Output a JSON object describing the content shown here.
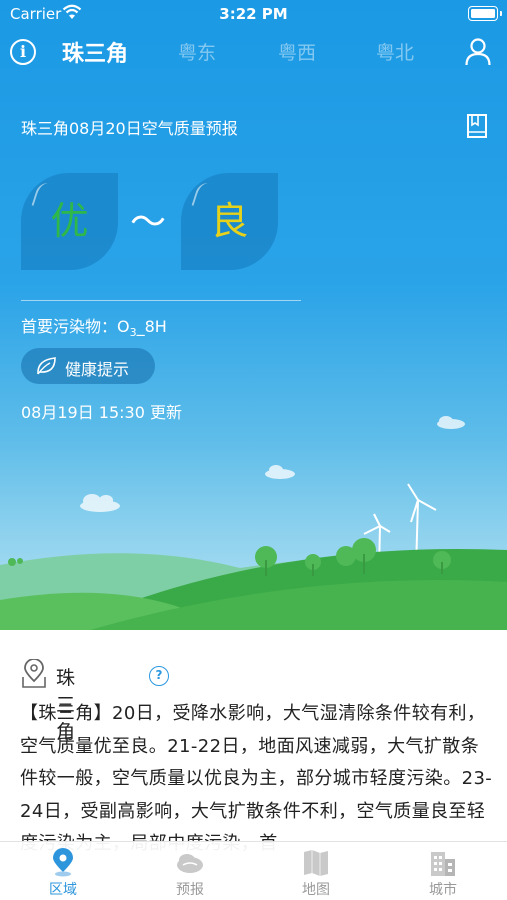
{
  "status_bar": {
    "carrier": "Carrier",
    "time": "3:22 PM"
  },
  "nav": {
    "tabs": [
      {
        "label": "珠三角",
        "active": true
      },
      {
        "label": "粤东",
        "active": false
      },
      {
        "label": "粤西",
        "active": false
      },
      {
        "label": "粤北",
        "active": false
      }
    ]
  },
  "forecast": {
    "title": "珠三角08月20日空气质量预报",
    "level_from": "优",
    "level_from_color": "#2fb84a",
    "separator": "～",
    "level_to": "良",
    "level_to_color": "#e7d21b",
    "pollutant_label": "首要污染物：",
    "pollutant_main": "O",
    "pollutant_sub": "3",
    "pollutant_suffix": "_8H",
    "health_button": "健康提示",
    "updated": "08月19日 15:30 更新"
  },
  "region": {
    "name": "珠三角",
    "help": "?",
    "description": "【珠三角】20日，受降水影响，大气湿清除条件较有利，空气质量优至良。21-22日，地面风速减弱，大气扩散条件较一般，空气质量以优良为主，部分城市轻度污染。23-24日，受副高影响，大气扩散条件不利，空气质量良至轻度污染为主，局部中度污染，首"
  },
  "tabbar": {
    "items": [
      {
        "label": "区域",
        "icon": "map-pin-icon",
        "active": true
      },
      {
        "label": "预报",
        "icon": "cloud-icon",
        "active": false
      },
      {
        "label": "地图",
        "icon": "folded-map-icon",
        "active": false
      },
      {
        "label": "城市",
        "icon": "buildings-icon",
        "active": false
      }
    ]
  },
  "colors": {
    "accent": "#2d95dc",
    "hero_top": "#1b99e4",
    "grass": "#4db54a"
  }
}
